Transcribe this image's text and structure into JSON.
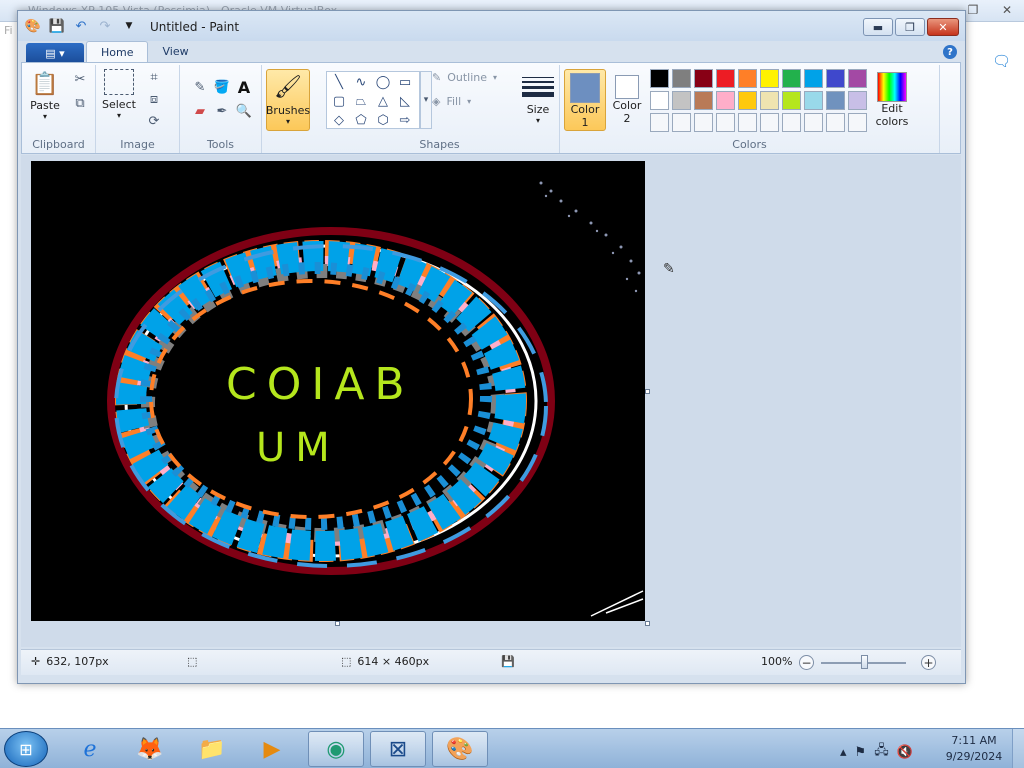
{
  "host": {
    "title": "Windows XP 105 Vista (Pessimia) - Oracle VM VirtualBox",
    "menu_label": "Fi"
  },
  "window": {
    "title": "Untitled - Paint",
    "qat": [
      "save-icon",
      "undo-icon",
      "redo-icon",
      "customize-icon"
    ]
  },
  "tabs": [
    {
      "label": "Home",
      "active": true
    },
    {
      "label": "View",
      "active": false
    }
  ],
  "ribbon": {
    "clipboard": {
      "label": "Clipboard",
      "paste": "Paste"
    },
    "image": {
      "label": "Image",
      "select": "Select"
    },
    "tools": {
      "label": "Tools"
    },
    "brushes": {
      "label": "Brushes"
    },
    "shapes": {
      "label": "Shapes",
      "outline": "Outline",
      "fill": "Fill"
    },
    "size": {
      "label": "Size"
    },
    "colors": {
      "label": "Colors",
      "color1_label": "Color",
      "color1_num": "1",
      "color2_label": "Color",
      "color2_num": "2",
      "edit": "Edit",
      "edit2": "colors",
      "color1": "#6d8fc0",
      "color2": "#ffffff",
      "palette": [
        "#000000",
        "#7f7f7f",
        "#880015",
        "#ed1c24",
        "#ff7f27",
        "#fff200",
        "#22b14c",
        "#00a2e8",
        "#3f48cc",
        "#a349a4",
        "#ffffff",
        "#c3c3c3",
        "#b97a57",
        "#ffaec9",
        "#ffc90e",
        "#efe4b0",
        "#b5e61d",
        "#99d9ea",
        "#7092be",
        "#c8bfe7",
        "#f5f7fa",
        "#f5f7fa",
        "#f5f7fa",
        "#f5f7fa",
        "#f5f7fa",
        "#f5f7fa",
        "#f5f7fa",
        "#f5f7fa",
        "#f5f7fa",
        "#f5f7fa"
      ]
    }
  },
  "canvas": {
    "text1": "COIAB",
    "text2": "UM"
  },
  "status": {
    "cursor_pos": "632, 107px",
    "image_size": "614 × 460px",
    "zoom": "100%"
  },
  "taskbar": {
    "apps": [
      "ie-icon",
      "firefox-icon",
      "explorer-icon",
      "media-player-icon",
      "vm-icon",
      "xp-icon",
      "paint-icon"
    ],
    "time": "7:11 AM",
    "date": "9/29/2024"
  }
}
